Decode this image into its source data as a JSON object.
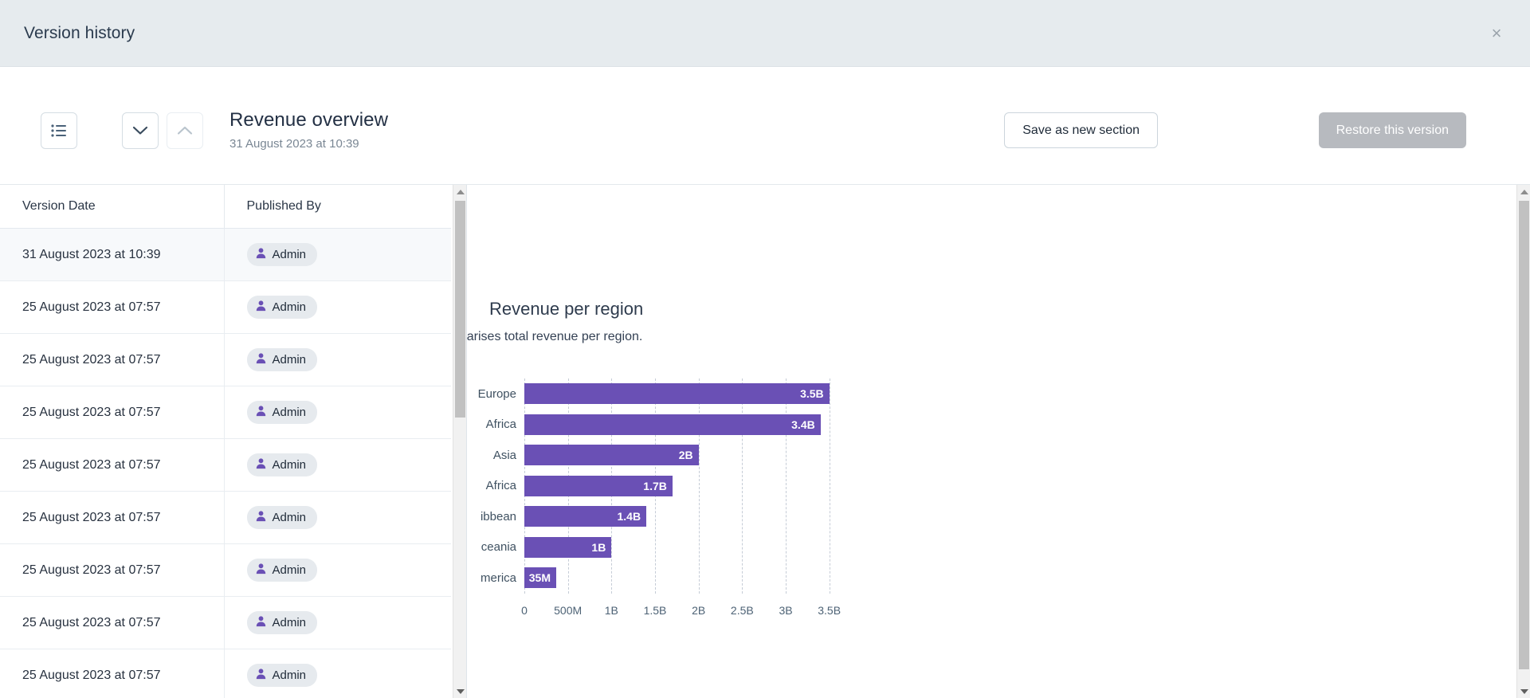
{
  "modal": {
    "title": "Version history",
    "close_label": "×"
  },
  "toolbar": {
    "list_icon": "list-icon",
    "down_icon": "chevron-down-icon",
    "up_icon": "chevron-up-icon",
    "heading": "Revenue overview",
    "subheading": "31 August 2023 at 10:39",
    "save_label": "Save as new section",
    "restore_label": "Restore this version"
  },
  "table": {
    "columns": [
      "Version Date",
      "Published By"
    ],
    "rows": [
      {
        "date": "31 August 2023 at 10:39",
        "user": "Admin",
        "selected": true
      },
      {
        "date": "25 August 2023 at 07:57",
        "user": "Admin",
        "selected": false
      },
      {
        "date": "25 August 2023 at 07:57",
        "user": "Admin",
        "selected": false
      },
      {
        "date": "25 August 2023 at 07:57",
        "user": "Admin",
        "selected": false
      },
      {
        "date": "25 August 2023 at 07:57",
        "user": "Admin",
        "selected": false
      },
      {
        "date": "25 August 2023 at 07:57",
        "user": "Admin",
        "selected": false
      },
      {
        "date": "25 August 2023 at 07:57",
        "user": "Admin",
        "selected": false
      },
      {
        "date": "25 August 2023 at 07:57",
        "user": "Admin",
        "selected": false
      },
      {
        "date": "25 August 2023 at 07:57",
        "user": "Admin",
        "selected": false
      }
    ]
  },
  "chart_data": {
    "type": "bar",
    "orientation": "horizontal",
    "title": "Revenue per region",
    "subtitle": "This chart summarises total revenue per region.",
    "subtitle_visible": "rt summarises total revenue per region.",
    "categories": [
      "Europe",
      "Africa",
      "Asia",
      "Africa",
      "Caribbean",
      "Oceania",
      "America"
    ],
    "categories_visible": [
      "Europe",
      "Africa",
      "Asia",
      "Africa",
      "ibbean",
      "ceania",
      "merica"
    ],
    "values": [
      3500000000,
      3400000000,
      2000000000,
      1700000000,
      1400000000,
      1000000000,
      35000000
    ],
    "value_labels": [
      "3.5B",
      "3.4B",
      "2B",
      "1.7B",
      "1.4B",
      "1B",
      "35M"
    ],
    "xlabel": "",
    "ylabel": "",
    "xlim": [
      0,
      3750000000
    ],
    "xticks": [
      0,
      500000000,
      1000000000,
      1500000000,
      2000000000,
      2500000000,
      3000000000,
      3500000000
    ],
    "xtick_labels": [
      "0",
      "500M",
      "1B",
      "1.5B",
      "2B",
      "2.5B",
      "3B",
      "3.5B"
    ],
    "grid": true,
    "legend": false,
    "bar_color": "#6a50b5"
  },
  "colors": {
    "accent": "#6a50b5",
    "header_bg": "#e6ebee",
    "chip_bg": "#e6eaee",
    "disabled_btn": "#b7babf"
  }
}
